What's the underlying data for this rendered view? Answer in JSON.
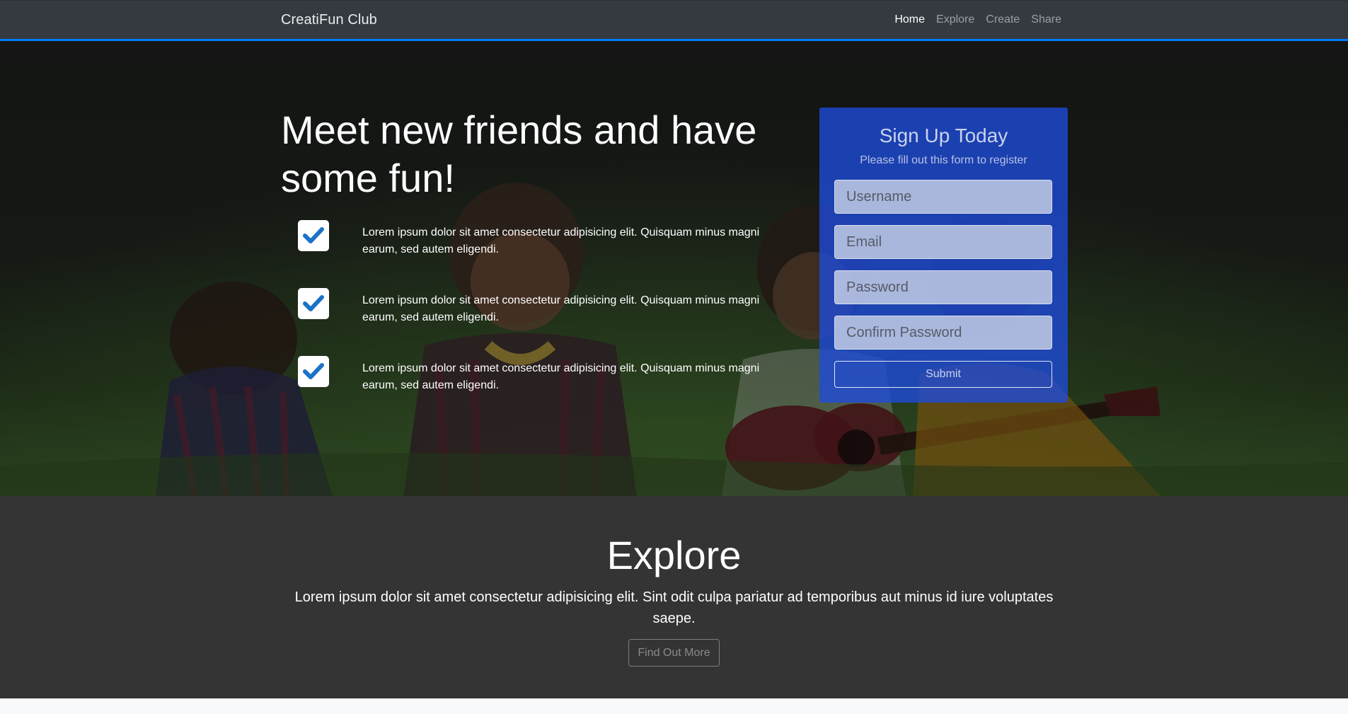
{
  "navbar": {
    "brand": "CreatiFun Club",
    "items": [
      {
        "label": "Home",
        "active": true
      },
      {
        "label": "Explore",
        "active": false
      },
      {
        "label": "Create",
        "active": false
      },
      {
        "label": "Share",
        "active": false
      }
    ]
  },
  "hero": {
    "title": "Meet new friends and have some fun!",
    "features": [
      {
        "icon": "check-icon",
        "text": "Lorem ipsum dolor sit amet consectetur adipisicing elit. Quisquam minus magni earum, sed autem eligendi."
      },
      {
        "icon": "check-icon",
        "text": "Lorem ipsum dolor sit amet consectetur adipisicing elit. Quisquam minus magni earum, sed autem eligendi."
      },
      {
        "icon": "check-icon",
        "text": "Lorem ipsum dolor sit amet consectetur adipisicing elit. Quisquam minus magni earum, sed autem eligendi."
      }
    ]
  },
  "signup": {
    "title": "Sign Up Today",
    "subtitle": "Please fill out this form to register",
    "fields": {
      "username": {
        "placeholder": "Username",
        "value": ""
      },
      "email": {
        "placeholder": "Email",
        "value": ""
      },
      "password": {
        "placeholder": "Password",
        "value": ""
      },
      "confirm": {
        "placeholder": "Confirm Password",
        "value": ""
      }
    },
    "submit_label": "Submit"
  },
  "explore": {
    "title": "Explore",
    "text": "Lorem ipsum dolor sit amet consectetur adipisicing elit. Sint odit culpa pariatur ad temporibus aut minus id iure voluptates saepe.",
    "button_label": "Find Out More"
  },
  "colors": {
    "accent": "#007bff",
    "navbar": "#343a40",
    "card": "#1e4cdc",
    "explore_bg": "#343434"
  }
}
